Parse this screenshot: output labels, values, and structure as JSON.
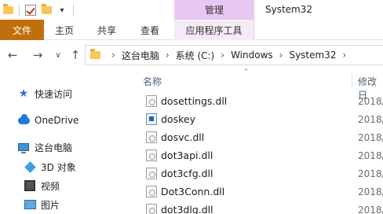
{
  "titlebar": {
    "manage_label": "管理",
    "window_title": "System32"
  },
  "ribbon": {
    "file": "文件",
    "home": "主页",
    "share": "共享",
    "view": "查看",
    "app_tools": "应用程序工具"
  },
  "address": {
    "crumbs": [
      "这台电脑",
      "系统 (C:)",
      "Windows",
      "System32"
    ]
  },
  "sidebar": {
    "quick_access": "快速访问",
    "onedrive": "OneDrive",
    "this_pc": "这台电脑",
    "objects_3d": "3D 对象",
    "videos": "视频",
    "pictures": "图片"
  },
  "columns": {
    "name": "名称",
    "modified": "修改日"
  },
  "files": [
    {
      "name": "dosettings.dll",
      "date": "2018/",
      "icon": "dll-file-icon"
    },
    {
      "name": "doskey",
      "date": "2018/",
      "icon": "exe-file-icon"
    },
    {
      "name": "dosvc.dll",
      "date": "2018/",
      "icon": "dll-file-icon"
    },
    {
      "name": "dot3api.dll",
      "date": "2018/",
      "icon": "dll-file-icon"
    },
    {
      "name": "dot3cfg.dll",
      "date": "2018/",
      "icon": "dll-file-icon"
    },
    {
      "name": "Dot3Conn.dll",
      "date": "2018/",
      "icon": "dll-file-icon"
    },
    {
      "name": "dot3dlg.dll",
      "date": "2018/",
      "icon": "dll-file-icon"
    }
  ],
  "colors": {
    "file_tab": "#c06f0c",
    "manage_tab": "#e8c7f2",
    "accent_blue": "#1f7ad6"
  }
}
